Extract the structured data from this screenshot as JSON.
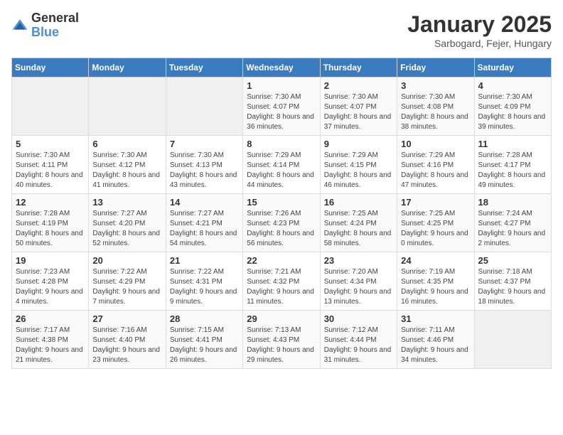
{
  "logo": {
    "general": "General",
    "blue": "Blue"
  },
  "title": "January 2025",
  "subtitle": "Sarbogard, Fejer, Hungary",
  "days_of_week": [
    "Sunday",
    "Monday",
    "Tuesday",
    "Wednesday",
    "Thursday",
    "Friday",
    "Saturday"
  ],
  "weeks": [
    [
      {
        "num": "",
        "detail": ""
      },
      {
        "num": "",
        "detail": ""
      },
      {
        "num": "",
        "detail": ""
      },
      {
        "num": "1",
        "detail": "Sunrise: 7:30 AM\nSunset: 4:07 PM\nDaylight: 8 hours and 36 minutes."
      },
      {
        "num": "2",
        "detail": "Sunrise: 7:30 AM\nSunset: 4:07 PM\nDaylight: 8 hours and 37 minutes."
      },
      {
        "num": "3",
        "detail": "Sunrise: 7:30 AM\nSunset: 4:08 PM\nDaylight: 8 hours and 38 minutes."
      },
      {
        "num": "4",
        "detail": "Sunrise: 7:30 AM\nSunset: 4:09 PM\nDaylight: 8 hours and 39 minutes."
      }
    ],
    [
      {
        "num": "5",
        "detail": "Sunrise: 7:30 AM\nSunset: 4:11 PM\nDaylight: 8 hours and 40 minutes."
      },
      {
        "num": "6",
        "detail": "Sunrise: 7:30 AM\nSunset: 4:12 PM\nDaylight: 8 hours and 41 minutes."
      },
      {
        "num": "7",
        "detail": "Sunrise: 7:30 AM\nSunset: 4:13 PM\nDaylight: 8 hours and 43 minutes."
      },
      {
        "num": "8",
        "detail": "Sunrise: 7:29 AM\nSunset: 4:14 PM\nDaylight: 8 hours and 44 minutes."
      },
      {
        "num": "9",
        "detail": "Sunrise: 7:29 AM\nSunset: 4:15 PM\nDaylight: 8 hours and 46 minutes."
      },
      {
        "num": "10",
        "detail": "Sunrise: 7:29 AM\nSunset: 4:16 PM\nDaylight: 8 hours and 47 minutes."
      },
      {
        "num": "11",
        "detail": "Sunrise: 7:28 AM\nSunset: 4:17 PM\nDaylight: 8 hours and 49 minutes."
      }
    ],
    [
      {
        "num": "12",
        "detail": "Sunrise: 7:28 AM\nSunset: 4:19 PM\nDaylight: 8 hours and 50 minutes."
      },
      {
        "num": "13",
        "detail": "Sunrise: 7:27 AM\nSunset: 4:20 PM\nDaylight: 8 hours and 52 minutes."
      },
      {
        "num": "14",
        "detail": "Sunrise: 7:27 AM\nSunset: 4:21 PM\nDaylight: 8 hours and 54 minutes."
      },
      {
        "num": "15",
        "detail": "Sunrise: 7:26 AM\nSunset: 4:23 PM\nDaylight: 8 hours and 56 minutes."
      },
      {
        "num": "16",
        "detail": "Sunrise: 7:25 AM\nSunset: 4:24 PM\nDaylight: 8 hours and 58 minutes."
      },
      {
        "num": "17",
        "detail": "Sunrise: 7:25 AM\nSunset: 4:25 PM\nDaylight: 9 hours and 0 minutes."
      },
      {
        "num": "18",
        "detail": "Sunrise: 7:24 AM\nSunset: 4:27 PM\nDaylight: 9 hours and 2 minutes."
      }
    ],
    [
      {
        "num": "19",
        "detail": "Sunrise: 7:23 AM\nSunset: 4:28 PM\nDaylight: 9 hours and 4 minutes."
      },
      {
        "num": "20",
        "detail": "Sunrise: 7:22 AM\nSunset: 4:29 PM\nDaylight: 9 hours and 7 minutes."
      },
      {
        "num": "21",
        "detail": "Sunrise: 7:22 AM\nSunset: 4:31 PM\nDaylight: 9 hours and 9 minutes."
      },
      {
        "num": "22",
        "detail": "Sunrise: 7:21 AM\nSunset: 4:32 PM\nDaylight: 9 hours and 11 minutes."
      },
      {
        "num": "23",
        "detail": "Sunrise: 7:20 AM\nSunset: 4:34 PM\nDaylight: 9 hours and 13 minutes."
      },
      {
        "num": "24",
        "detail": "Sunrise: 7:19 AM\nSunset: 4:35 PM\nDaylight: 9 hours and 16 minutes."
      },
      {
        "num": "25",
        "detail": "Sunrise: 7:18 AM\nSunset: 4:37 PM\nDaylight: 9 hours and 18 minutes."
      }
    ],
    [
      {
        "num": "26",
        "detail": "Sunrise: 7:17 AM\nSunset: 4:38 PM\nDaylight: 9 hours and 21 minutes."
      },
      {
        "num": "27",
        "detail": "Sunrise: 7:16 AM\nSunset: 4:40 PM\nDaylight: 9 hours and 23 minutes."
      },
      {
        "num": "28",
        "detail": "Sunrise: 7:15 AM\nSunset: 4:41 PM\nDaylight: 9 hours and 26 minutes."
      },
      {
        "num": "29",
        "detail": "Sunrise: 7:13 AM\nSunset: 4:43 PM\nDaylight: 9 hours and 29 minutes."
      },
      {
        "num": "30",
        "detail": "Sunrise: 7:12 AM\nSunset: 4:44 PM\nDaylight: 9 hours and 31 minutes."
      },
      {
        "num": "31",
        "detail": "Sunrise: 7:11 AM\nSunset: 4:46 PM\nDaylight: 9 hours and 34 minutes."
      },
      {
        "num": "",
        "detail": ""
      }
    ]
  ]
}
